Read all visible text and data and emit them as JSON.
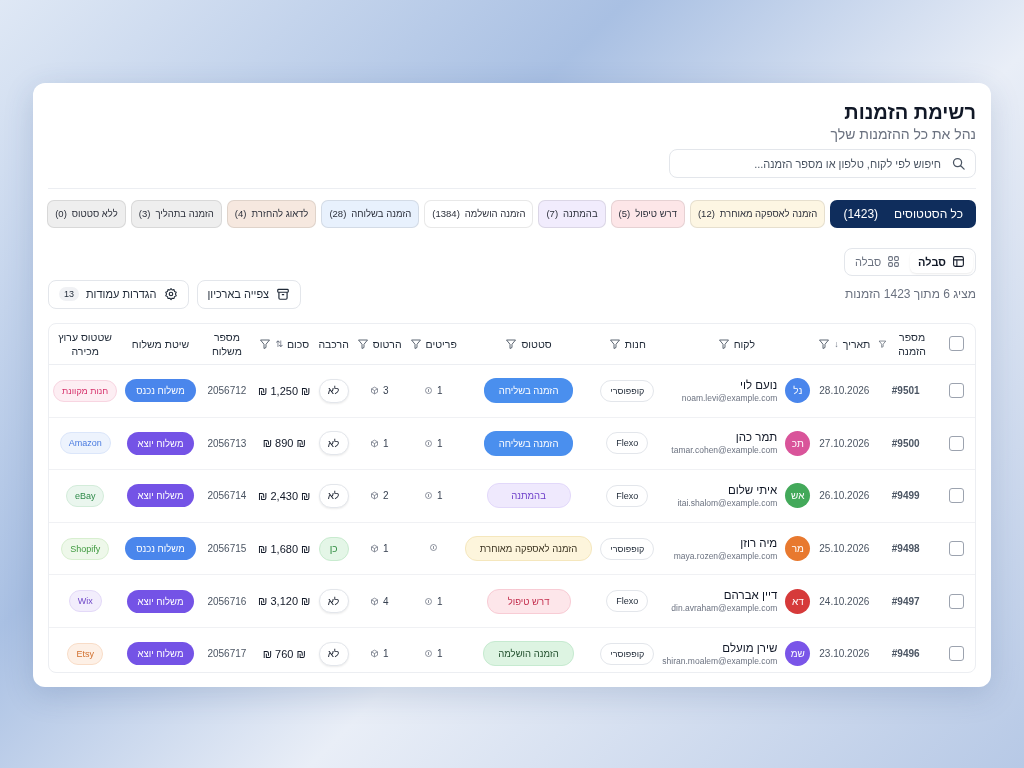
{
  "header": {
    "title": "רשימת הזמנות",
    "subtitle": "נהל את כל ההזמנות שלך"
  },
  "search": {
    "placeholder": "חיפוש לפי לקוח, טלפון או מספר הזמנה..."
  },
  "status_tabs": [
    {
      "label": "כל הסטטוסים",
      "count": "(1423)",
      "color": "#0f2d5c",
      "selected": true
    },
    {
      "label": "הזמנה לאספקה מאוחרת",
      "count": "(12)",
      "color": "#fdf6e3",
      "selected": false
    },
    {
      "label": "דרש טיפול",
      "count": "(5)",
      "color": "#fde6e8",
      "selected": false
    },
    {
      "label": "בהמתנה",
      "count": "(7)",
      "color": "#f1ecfd",
      "selected": false
    },
    {
      "label": "הזמנה הושלמה",
      "count": "(1384)",
      "color": "#ffffff",
      "selected": false
    },
    {
      "label": "הזמנה בשלוחה",
      "count": "(28)",
      "color": "#e8f1fd",
      "selected": false
    },
    {
      "label": "לדאוג להחזרת",
      "count": "(4)",
      "color": "#f6e8df",
      "selected": false
    },
    {
      "label": "הזמנה בתהליך",
      "count": "(3)",
      "color": "#eeeeee",
      "selected": false
    },
    {
      "label": "ללא סטטוס",
      "count": "(0)",
      "color": "#eeeeee",
      "selected": false
    }
  ],
  "view_toggle": [
    {
      "kind": "table",
      "label": "סבלה",
      "selected": true
    },
    {
      "kind": "grid",
      "label": "סבלה",
      "selected": false
    }
  ],
  "summary": "מציג 6 מתוך 1423 הזמנות",
  "toolbar": [
    {
      "kind": "archive",
      "label": "צפייה בארכיון"
    },
    {
      "kind": "settings",
      "label": "הגדרות עמודות",
      "badge": "13"
    }
  ],
  "table": {
    "select_all": {
      "checked": false
    },
    "columns": [
      {
        "label": "מספר הזמנה",
        "filter": true
      },
      {
        "label": "תאריך",
        "filter": true,
        "sort": "↓"
      },
      {
        "label": "לקוח",
        "filter": true
      },
      {
        "label": "חנות",
        "filter": true
      },
      {
        "label": "סטטוס",
        "filter": true
      },
      {
        "label": "פריטים",
        "filter": true
      },
      {
        "label": "הרטוס",
        "filter": true
      },
      {
        "label": "הרכבה",
        "filter": false
      },
      {
        "label": "סכום",
        "filter": true,
        "sort": "⇅"
      },
      {
        "label": "מספר משלוח",
        "filter": false
      },
      {
        "label": "שיטת משלוח",
        "filter": false
      },
      {
        "label": "שטטוס ערוץ מכירה",
        "filter": false
      }
    ],
    "rows": [
      {
        "checked": false,
        "order": "#9501",
        "date": "28.10.2026",
        "initials": "נל",
        "color": "#4a86ec",
        "name": "נועם לוי",
        "email": "noam.levi@example.com",
        "store": "קופפוסרי",
        "status": {
          "kind": "shipping",
          "label": "הזמנה בשליחה"
        },
        "items": "1",
        "cartons": "3",
        "assembly": {
          "kind": "no",
          "label": "לא"
        },
        "amount": "₪ 1,250 ₪",
        "shipment": "2056712",
        "method": {
          "kind": "incoming",
          "label": "משלוח נכנס"
        },
        "channel": {
          "label": "חנות מקוונת",
          "kind": "pink"
        }
      },
      {
        "checked": false,
        "order": "#9500",
        "date": "27.10.2026",
        "initials": "תכ",
        "color": "#d9549a",
        "name": "תמר כהן",
        "email": "tamar.cohen@example.com",
        "store": "Flexo",
        "status": {
          "kind": "shipping",
          "label": "הזמנה בשליחה"
        },
        "items": "1",
        "cartons": "1",
        "assembly": {
          "kind": "no",
          "label": "לא"
        },
        "amount": "₪ 890 ₪",
        "shipment": "2056713",
        "method": {
          "kind": "outgoing",
          "label": "משלוח יוצא"
        },
        "channel": {
          "label": "Amazon",
          "kind": "blue"
        }
      },
      {
        "checked": false,
        "order": "#9499",
        "date": "26.10.2026",
        "initials": "אש",
        "color": "#43a95a",
        "name": "איתי שלום",
        "email": "itai.shalom@example.com",
        "store": "Flexo",
        "status": {
          "kind": "pending",
          "label": "בהמתנה"
        },
        "items": "1",
        "cartons": "2",
        "assembly": {
          "kind": "no",
          "label": "לא"
        },
        "amount": "₪ 2,430 ₪",
        "shipment": "2056714",
        "method": {
          "kind": "outgoing",
          "label": "משלוח יוצא"
        },
        "channel": {
          "label": "eBay",
          "kind": "teal"
        }
      },
      {
        "checked": false,
        "order": "#9498",
        "date": "25.10.2026",
        "initials": "מר",
        "color": "#e8792f",
        "name": "מיה רוזן",
        "email": "maya.rozen@example.com",
        "store": "קופפוסרי",
        "status": {
          "kind": "late",
          "label": "הזמנה לאספקה מאוחרת"
        },
        "items": "",
        "cartons": "1",
        "assembly": {
          "kind": "yes",
          "label": "כן"
        },
        "amount": "₪ 1,680 ₪",
        "shipment": "2056715",
        "method": {
          "kind": "incoming",
          "label": "משלוח נכנס"
        },
        "channel": {
          "label": "Shopify",
          "kind": "lime"
        }
      },
      {
        "checked": false,
        "order": "#9497",
        "date": "24.10.2026",
        "initials": "דא",
        "color": "#d63a3a",
        "name": "דיין אברהם",
        "email": "din.avraham@example.com",
        "store": "Flexo",
        "status": {
          "kind": "attention",
          "label": "דרש טיפול"
        },
        "items": "1",
        "cartons": "4",
        "assembly": {
          "kind": "no",
          "label": "לא"
        },
        "amount": "₪ 3,120 ₪",
        "shipment": "2056716",
        "method": {
          "kind": "outgoing",
          "label": "משלוח יוצא"
        },
        "channel": {
          "label": "Wix",
          "kind": "purple"
        }
      },
      {
        "checked": false,
        "order": "#9496",
        "date": "23.10.2026",
        "initials": "שמ",
        "color": "#7a55e8",
        "name": "שירן מועלם",
        "email": "shiran.moalem@example.com",
        "store": "קופפוסרי",
        "status": {
          "kind": "done",
          "label": "הזמנה הושלמה"
        },
        "items": "1",
        "cartons": "1",
        "assembly": {
          "kind": "no",
          "label": "לא"
        },
        "amount": "₪ 760 ₪",
        "shipment": "2056717",
        "method": {
          "kind": "outgoing",
          "label": "משלוח יוצא"
        },
        "channel": {
          "label": "Etsy",
          "kind": "orange"
        }
      }
    ]
  }
}
